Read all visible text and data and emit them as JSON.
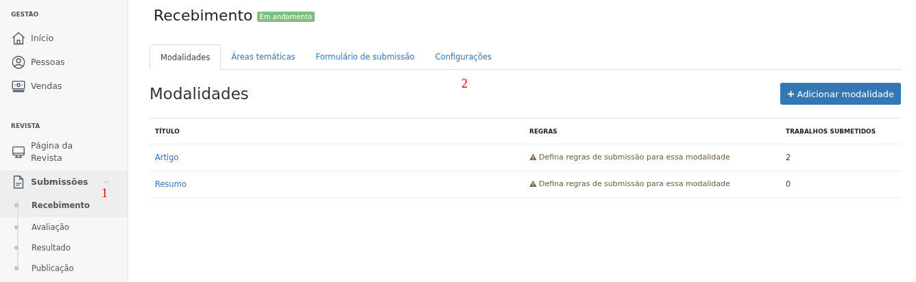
{
  "sidebar": {
    "sections": [
      {
        "title": "GESTÃO",
        "items": [
          {
            "label": "Início",
            "selected": false
          },
          {
            "label": "Pessoas",
            "selected": false
          },
          {
            "label": "Vendas",
            "selected": false
          }
        ]
      },
      {
        "title": "REVISTA",
        "items": [
          {
            "label": "Página da Revista",
            "selected": false
          },
          {
            "label": "Submissões",
            "selected": true,
            "expanded": true,
            "children": [
              {
                "label": "Recebimento",
                "selected": true
              },
              {
                "label": "Avaliação",
                "selected": false
              },
              {
                "label": "Resultado",
                "selected": false
              },
              {
                "label": "Publicação",
                "selected": false
              }
            ]
          }
        ]
      }
    ]
  },
  "page": {
    "title": "Recebimento",
    "status": "Em andamento"
  },
  "tabs": [
    {
      "label": "Modalidades",
      "selected": true
    },
    {
      "label": "Áreas temáticas",
      "selected": false
    },
    {
      "label": "Formulário de submissão",
      "selected": false
    },
    {
      "label": "Configurações",
      "selected": false
    }
  ],
  "section": {
    "title": "Modalidades",
    "button": "Adicionar modalidade"
  },
  "table": {
    "columns": [
      "TÍTULO",
      "REGRAS",
      "TRABALHOS SUBMETIDOS"
    ],
    "rows": [
      {
        "title": "Artigo",
        "rule": "Defina regras de submissão para essa modalidade",
        "count": "2"
      },
      {
        "title": "Resumo",
        "rule": "Defina regras de submissão para essa modalidade",
        "count": "0"
      }
    ]
  },
  "annotations": [
    {
      "label": "1"
    },
    {
      "label": "2"
    }
  ]
}
